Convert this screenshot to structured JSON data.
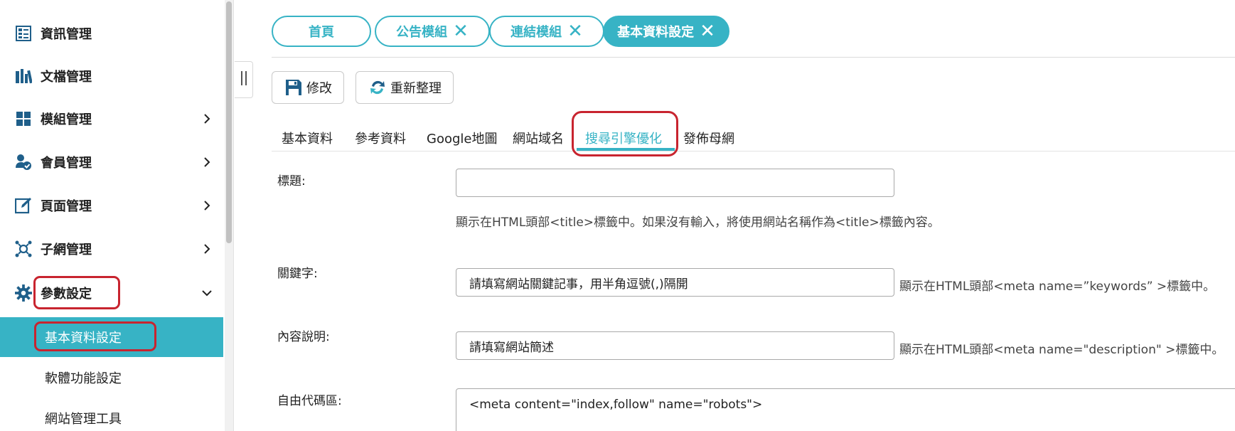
{
  "sidebar": {
    "items": [
      {
        "label": "資訊管理",
        "icon": "list-icon"
      },
      {
        "label": "文檔管理",
        "icon": "library-icon"
      },
      {
        "label": "模組管理",
        "icon": "grid-icon"
      },
      {
        "label": "會員管理",
        "icon": "user-check-icon"
      },
      {
        "label": "頁面管理",
        "icon": "edit-icon"
      },
      {
        "label": "子網管理",
        "icon": "network-icon"
      },
      {
        "label": "參數設定",
        "icon": "gear-icon"
      }
    ],
    "subitems": [
      {
        "label": "基本資料設定",
        "active": true
      },
      {
        "label": "軟體功能設定",
        "active": false
      },
      {
        "label": "網站管理工具",
        "active": false
      }
    ]
  },
  "tabs": [
    {
      "label": "首頁",
      "closable": false
    },
    {
      "label": "公告模組",
      "closable": true
    },
    {
      "label": "連結模組",
      "closable": true
    },
    {
      "label": "基本資料設定",
      "closable": true,
      "active": true
    }
  ],
  "tab_close_glyph": "✕",
  "toolbar": {
    "save_label": "修改",
    "refresh_label": "重新整理"
  },
  "subtabs": [
    "基本資料",
    "參考資料",
    "Google地圖",
    "網站域名",
    "搜尋引擎優化",
    "發佈母網"
  ],
  "form": {
    "title_label": "標題:",
    "title_value": "",
    "title_hint": "顯示在HTML頭部<title>標籤中。如果沒有輸入，將使用網站名稱作為<title>標籤內容。",
    "keywords_label": "關鍵字:",
    "keywords_value": "請填寫網站關鍵記事，用半角逗號(,)隔開",
    "keywords_hint": "顯示在HTML頭部<meta name=”keywords” >標籤中。",
    "description_label": "內容說明:",
    "description_value": "請填寫網站簡述",
    "description_hint": "顯示在HTML頭部<meta name=\"description\" >標籤中。",
    "code_label": "自由代碼區:",
    "code_value": "<meta content=\"index,follow\" name=\"robots\">"
  },
  "colors": {
    "accent": "#37b3c5",
    "highlight": "#c8242f",
    "icon": "#1f5f8a"
  }
}
